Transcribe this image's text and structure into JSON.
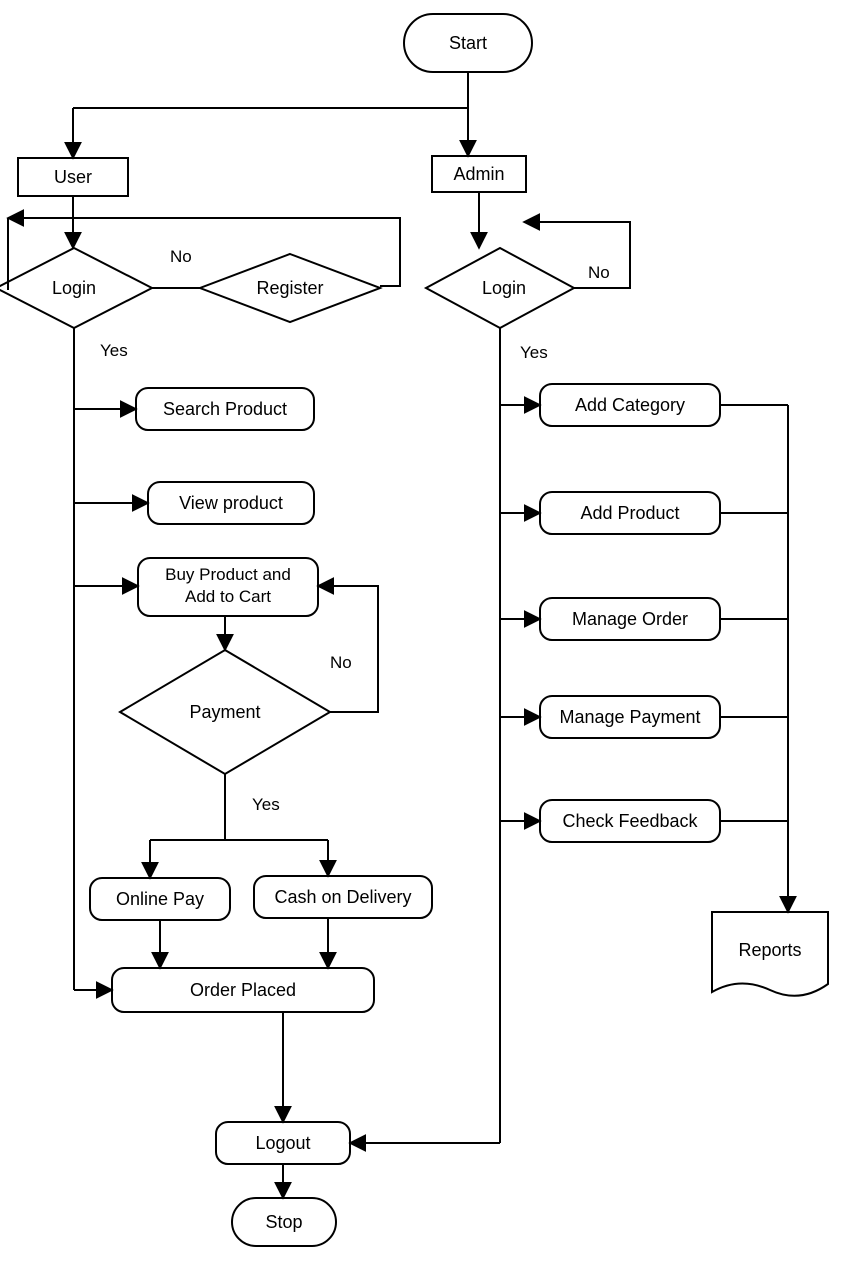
{
  "nodes": {
    "start": "Start",
    "user": "User",
    "admin": "Admin",
    "user_login": "Login",
    "register": "Register",
    "admin_login": "Login",
    "search_product": "Search Product",
    "view_product": "View product",
    "buy_add_cart_l1": "Buy Product and",
    "buy_add_cart_l2": "Add to Cart",
    "payment": "Payment",
    "online_pay": "Online Pay",
    "cod": "Cash on Delivery",
    "order_placed": "Order Placed",
    "logout": "Logout",
    "stop": "Stop",
    "add_category": "Add Category",
    "add_product": "Add Product",
    "manage_order": "Manage Order",
    "manage_payment": "Manage Payment",
    "check_feedback": "Check Feedback",
    "reports": "Reports"
  },
  "edges": {
    "yes": "Yes",
    "no": "No"
  }
}
